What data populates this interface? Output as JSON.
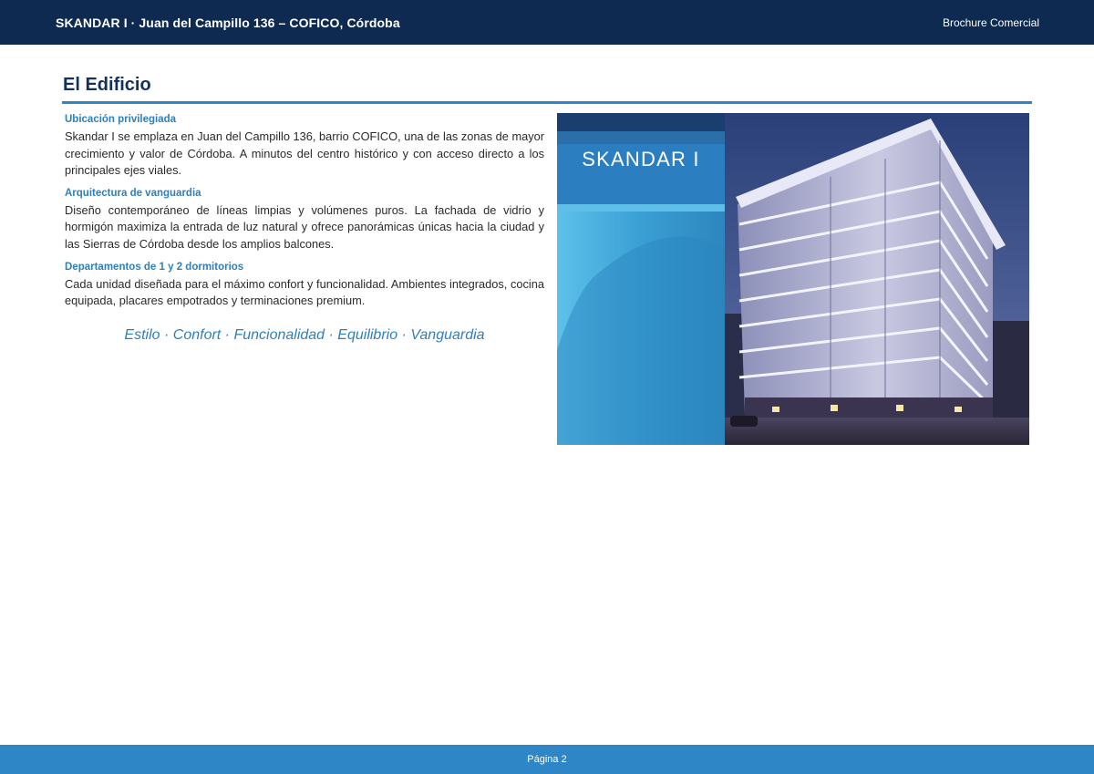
{
  "header": {
    "title": "SKANDAR I  ·  Juan del Campillo 136 – COFICO, Córdoba",
    "doc_type": "Brochure Comercial"
  },
  "section": {
    "title": "El Edificio"
  },
  "blocks": [
    {
      "heading": "Ubicación privilegiada",
      "body": "Skandar I se emplaza en Juan del Campillo 136, barrio COFICO, una de las zonas de mayor crecimiento y valor de Córdoba. A minutos del centro histórico y con acceso directo a los principales ejes viales."
    },
    {
      "heading": "Arquitectura de vanguardia",
      "body": "Diseño contemporáneo de líneas limpias y volúmenes puros. La fachada de vidrio y hormigón maximiza la entrada de luz natural y ofrece panorámicas únicas hacia la ciudad y las Sierras de Córdoba desde los amplios balcones."
    },
    {
      "heading": "Departamentos de 1 y 2 dormitorios",
      "body": "Cada unidad diseñada para el máximo confort y funcionalidad. Ambientes integrados, cocina equipada, placares empotrados y terminaciones premium."
    }
  ],
  "tagline": "Estilo · Confort · Funcionalidad · Equilibrio · Vanguardia",
  "photo": {
    "sign_text": "SKANDAR I"
  },
  "footer": {
    "page_label": "Página 2"
  },
  "colors": {
    "header_bg": "#0e2a50",
    "accent": "#2f86c7",
    "heading_blue": "#2f7fba",
    "title_navy": "#14315a"
  }
}
